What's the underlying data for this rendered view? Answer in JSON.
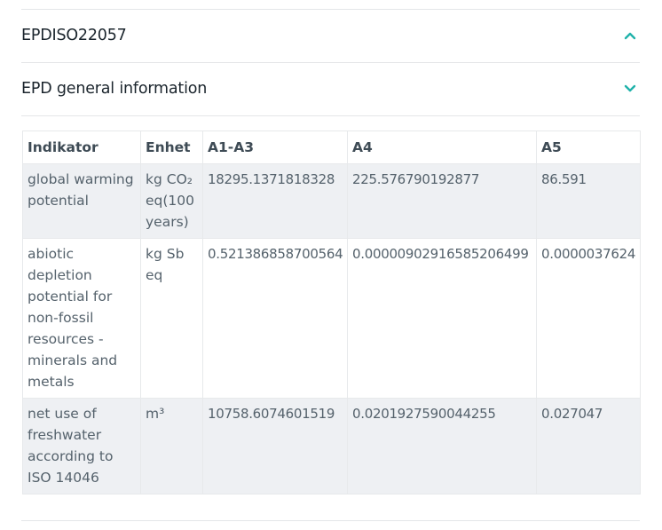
{
  "sections": [
    {
      "title": "EPDISO22057",
      "expanded": false
    },
    {
      "title": "EPD general information",
      "expanded": true
    }
  ],
  "accent_color": "#20b2aa",
  "table": {
    "headers": [
      "Indikator",
      "Enhet",
      "A1-A3",
      "A4",
      "A5"
    ],
    "rows": [
      [
        "global warming potential",
        "kg CO₂ eq(100 years)",
        "18295.1371818328",
        "225.576790192877",
        "86.591"
      ],
      [
        "abiotic depletion potential for non-fossil resources - minerals and metals",
        "kg Sb eq",
        "0.521386858700564",
        "0.0000090291658520649​9",
        "0.0000037624"
      ],
      [
        "net use of freshwater according to ISO 14046",
        "m³",
        "10758.6074601519",
        "0.0201927590044255",
        "0.027047"
      ]
    ]
  }
}
